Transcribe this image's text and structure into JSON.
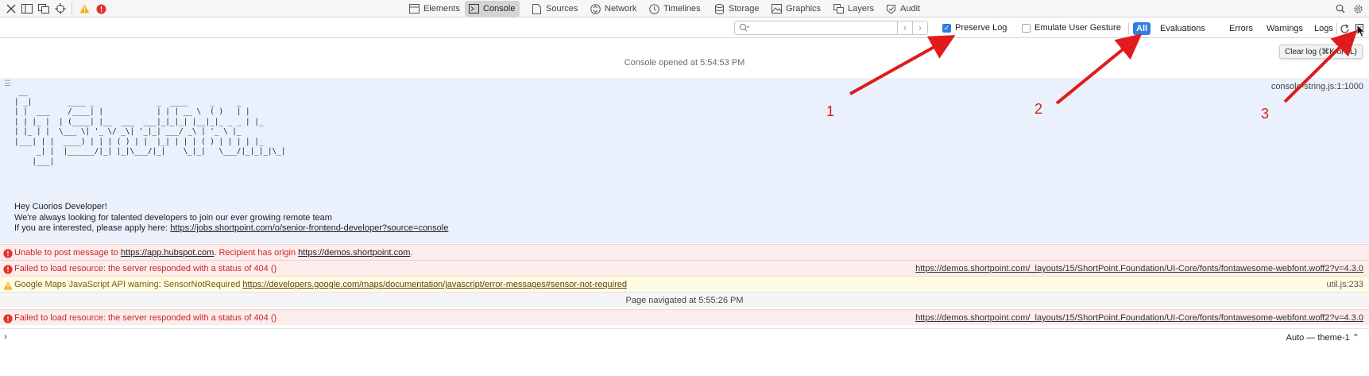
{
  "tabbar": {
    "tabs": [
      {
        "label": "Elements",
        "icon": "elements-icon"
      },
      {
        "label": "Console",
        "icon": "console-icon",
        "active": true
      },
      {
        "label": "Sources",
        "icon": "sources-icon"
      },
      {
        "label": "Network",
        "icon": "network-icon"
      },
      {
        "label": "Timelines",
        "icon": "timelines-icon"
      },
      {
        "label": "Storage",
        "icon": "storage-icon"
      },
      {
        "label": "Graphics",
        "icon": "graphics-icon"
      },
      {
        "label": "Layers",
        "icon": "layers-icon"
      },
      {
        "label": "Audit",
        "icon": "audit-icon"
      }
    ]
  },
  "filterbar": {
    "search_placeholder": "",
    "preserve_log_label": "Preserve Log",
    "preserve_log_checked": true,
    "emulate_gesture_label": "Emulate User Gesture",
    "emulate_gesture_checked": false,
    "filters": [
      "All",
      "Evaluations",
      "Errors",
      "Warnings",
      "Logs"
    ],
    "active_filter": "All"
  },
  "tooltip": {
    "text": "Clear log (⌘K or ^L)"
  },
  "console": {
    "opened_text": "Console opened at 5:54:53 PM",
    "log_source": "console-string.js:1:1000",
    "ascii_art": " __\n| _|        ____ _              _  ____     _     _\n| |  ___    /____| |            | | | __ \\  ( )   | |\n| | |_ |  | (____| |__  ___  ___|_|_|_| |__|_|_ _ _ | |_\n| |_ | |  \\___ \\| '_ \\/ _\\| '_|_| ___/ _\\ | '_ \\ |_\n|___| | |  ____) | | | ( ) | |  |_| | | | ( ) | | | | |_\n     _| |  |______/|_| |_|\\___/|_|    \\_|_|   \\___/|_|_|_|\\_|\n    |___|",
    "msg_line1": "Hey Cuorios Developer!",
    "msg_line2": "We're always looking for talented developers to join our ever growing remote team",
    "msg_line3_prefix": "If you are interested, please apply here: ",
    "msg_link": "https://jobs.shortpoint.com/o/senior-frontend-developer?source=console",
    "row1_prefix": "Unable to post message to ",
    "row1_link1": "https://app.hubspot.com",
    "row1_mid": ". Recipient has origin ",
    "row1_link2": "https://demos.shortpoint.com",
    "row1_suffix": ".",
    "row2_text": "Failed to load resource: the server responded with a status of 404 ()",
    "row2_source": "https://demos.shortpoint.com/_layouts/15/ShortPoint.Foundation/UI-Core/fonts/fontawesome-webfont.woff2?v=4.3.0",
    "row3_prefix": "Google Maps JavaScript API warning: SensorNotRequired ",
    "row3_link": "https://developers.google.com/maps/documentation/javascript/error-messages#sensor-not-required",
    "row3_source": "util.js:233",
    "nav_text": "Page navigated at 5:55:26 PM",
    "row4_text": "Failed to load resource: the server responded with a status of 404 ()",
    "row4_source": "https://demos.shortpoint.com/_layouts/15/ShortPoint.Foundation/UI-Core/fonts/fontawesome-webfont.woff2?v=4.3.0"
  },
  "prompt": {
    "context_label": "Auto — theme-1"
  },
  "annotations": {
    "n1": "1",
    "n2": "2",
    "n3": "3",
    "color": "#e01b1b"
  }
}
